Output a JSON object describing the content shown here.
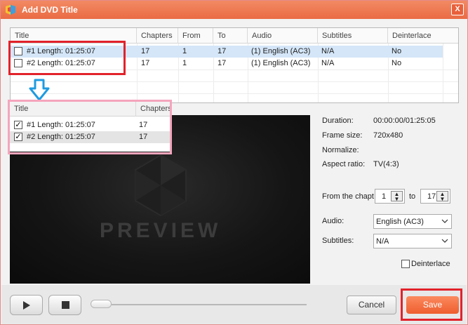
{
  "window": {
    "title": "Add DVD Title",
    "close_label": "X"
  },
  "table": {
    "columns": [
      "Title",
      "Chapters",
      "From",
      "To",
      "Audio",
      "Subtitles",
      "Deinterlace"
    ],
    "rows": [
      {
        "title": "#1 Length: 01:25:07",
        "chapters": "17",
        "from": "1",
        "to": "17",
        "audio": "(1) English (AC3)",
        "subtitles": "N/A",
        "deinterlace": "No",
        "checked": false,
        "selected": true
      },
      {
        "title": "#2 Length: 01:25:07",
        "chapters": "17",
        "from": "1",
        "to": "17",
        "audio": "(1) English (AC3)",
        "subtitles": "N/A",
        "deinterlace": "No",
        "checked": false,
        "selected": false
      }
    ]
  },
  "zoom_table": {
    "columns": [
      "Title",
      "Chapters"
    ],
    "rows": [
      {
        "title": "#1 Length: 01:25:07",
        "chapters": "17",
        "checked": true
      },
      {
        "title": "#2 Length: 01:25:07",
        "chapters": "17",
        "checked": true
      }
    ]
  },
  "preview": {
    "watermark": "PREVIEW"
  },
  "info": {
    "duration_label": "Duration:",
    "duration_value": "00:00:00/01:25:05",
    "frame_size_label": "Frame size:",
    "frame_size_value": "720x480",
    "normalize_label": "Normalize:",
    "aspect_label": "Aspect ratio:",
    "aspect_value": "TV(4:3)",
    "chapter_label": "From the chapt",
    "chapter_from": "1",
    "chapter_to_label": "to",
    "chapter_to": "17",
    "audio_label": "Audio:",
    "audio_value": "English (AC3)",
    "subtitles_label": "Subtitles:",
    "subtitles_value": "N/A",
    "deinterlace_label": "Deinterlace"
  },
  "controls": {
    "cancel_label": "Cancel",
    "save_label": "Save",
    "progress": 0
  },
  "colors": {
    "titlebar": "#ea6b44",
    "highlight_red": "#e2222b",
    "highlight_pink": "#f4a5bd",
    "arrow_blue": "#1e9be0",
    "save_button": "#ef5e2f"
  }
}
